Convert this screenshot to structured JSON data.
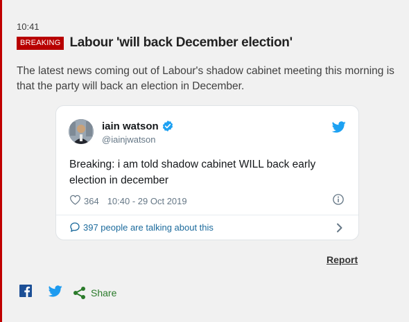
{
  "post": {
    "time": "10:41",
    "badge": "BREAKING",
    "headline": "Labour 'will back December election'",
    "summary": "The latest news coming out of Labour's shadow cabinet meeting this morning is that the party will back an election in December."
  },
  "tweet": {
    "name": "iain watson",
    "handle": "@iainjwatson",
    "text_line1": "Breaking: i am told shadow cabinet WILL back early",
    "text_line2": "election in december",
    "likes": "364",
    "timestamp": "10:40 - 29 Oct 2019",
    "talking": "397 people are talking about this"
  },
  "actions": {
    "report": "Report",
    "share": "Share"
  },
  "colors": {
    "accent_red": "#b80000",
    "twitter_blue": "#1da1f2",
    "share_green": "#2a7a2a"
  },
  "icons": [
    "heart-icon",
    "verified-icon",
    "twitter-bird-icon",
    "info-icon",
    "comment-icon",
    "chevron-right-icon",
    "facebook-icon",
    "share-icon"
  ]
}
